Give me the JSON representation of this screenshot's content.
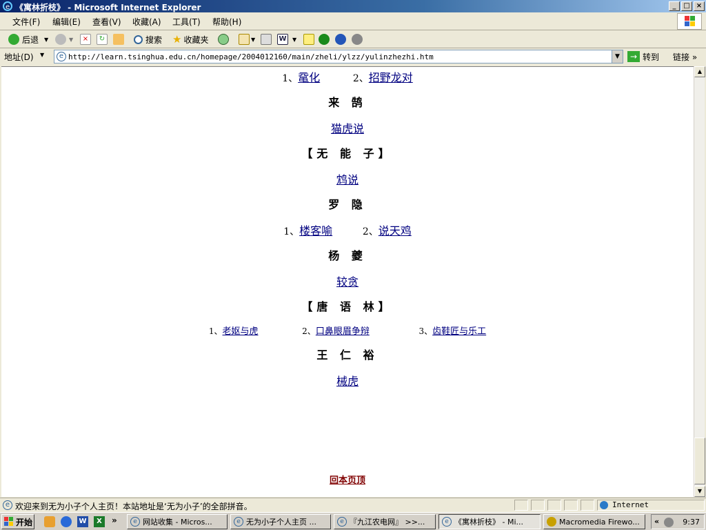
{
  "window": {
    "title": "《寓林折枝》 - Microsoft Internet Explorer",
    "buttons": [
      "_",
      "□",
      "×"
    ]
  },
  "menubar": {
    "items": [
      "文件(F)",
      "编辑(E)",
      "查看(V)",
      "收藏(A)",
      "工具(T)",
      "帮助(H)"
    ]
  },
  "toolbar": {
    "back_label": "后退",
    "search_label": "搜索",
    "favorites_label": "收藏夹"
  },
  "addressbar": {
    "label": "地址(D)",
    "url": "http://learn.tsinghua.edu.cn/homepage/2004012160/main/zheli/ylzz/yulinzhezhi.htm",
    "go_label": "转到",
    "links_label": "链接 »"
  },
  "content": {
    "row0": {
      "n1": "1、",
      "l1": "鼋化",
      "n2": "2、",
      "l2": "招野龙对"
    },
    "author1": "来 鹄",
    "link1": "猫虎说",
    "author2": "【无 能 子】",
    "link2": "鸩说",
    "author3": "罗 隐",
    "row3": {
      "n1": "1、",
      "l1": "楼客喻",
      "n2": "2、",
      "l2": "说天鸡"
    },
    "author4": "杨 夔",
    "link4": "较贪",
    "author5": "【唐 语 林】",
    "row5": {
      "n1": "1、",
      "l1": "老妪与虎",
      "n2": "2、",
      "l2": "口鼻眼眉争辩",
      "n3": "3、",
      "l3": "齿鞋匠与乐工"
    },
    "author6": "王 仁 裕",
    "link6": "械虎",
    "back_to_top": "回本页顶"
  },
  "statusbar": {
    "message": "欢迎来到无为小子个人主页！本站地址是‘无为小子’的全部拼音。",
    "zone": "Internet"
  },
  "taskbar": {
    "start": "开始",
    "tasks": [
      "网站收集 - Micros...",
      "无为小子个人主页 ...",
      "『九江农电网』 >>...",
      "《寓林折枝》 - Mi...",
      "Macromedia Firewo..."
    ],
    "clock": "9:37",
    "tray_chevron": "«"
  },
  "colors": {
    "link": "#000080",
    "back_to_top": "#800000",
    "titlebar": "#0a246a"
  }
}
